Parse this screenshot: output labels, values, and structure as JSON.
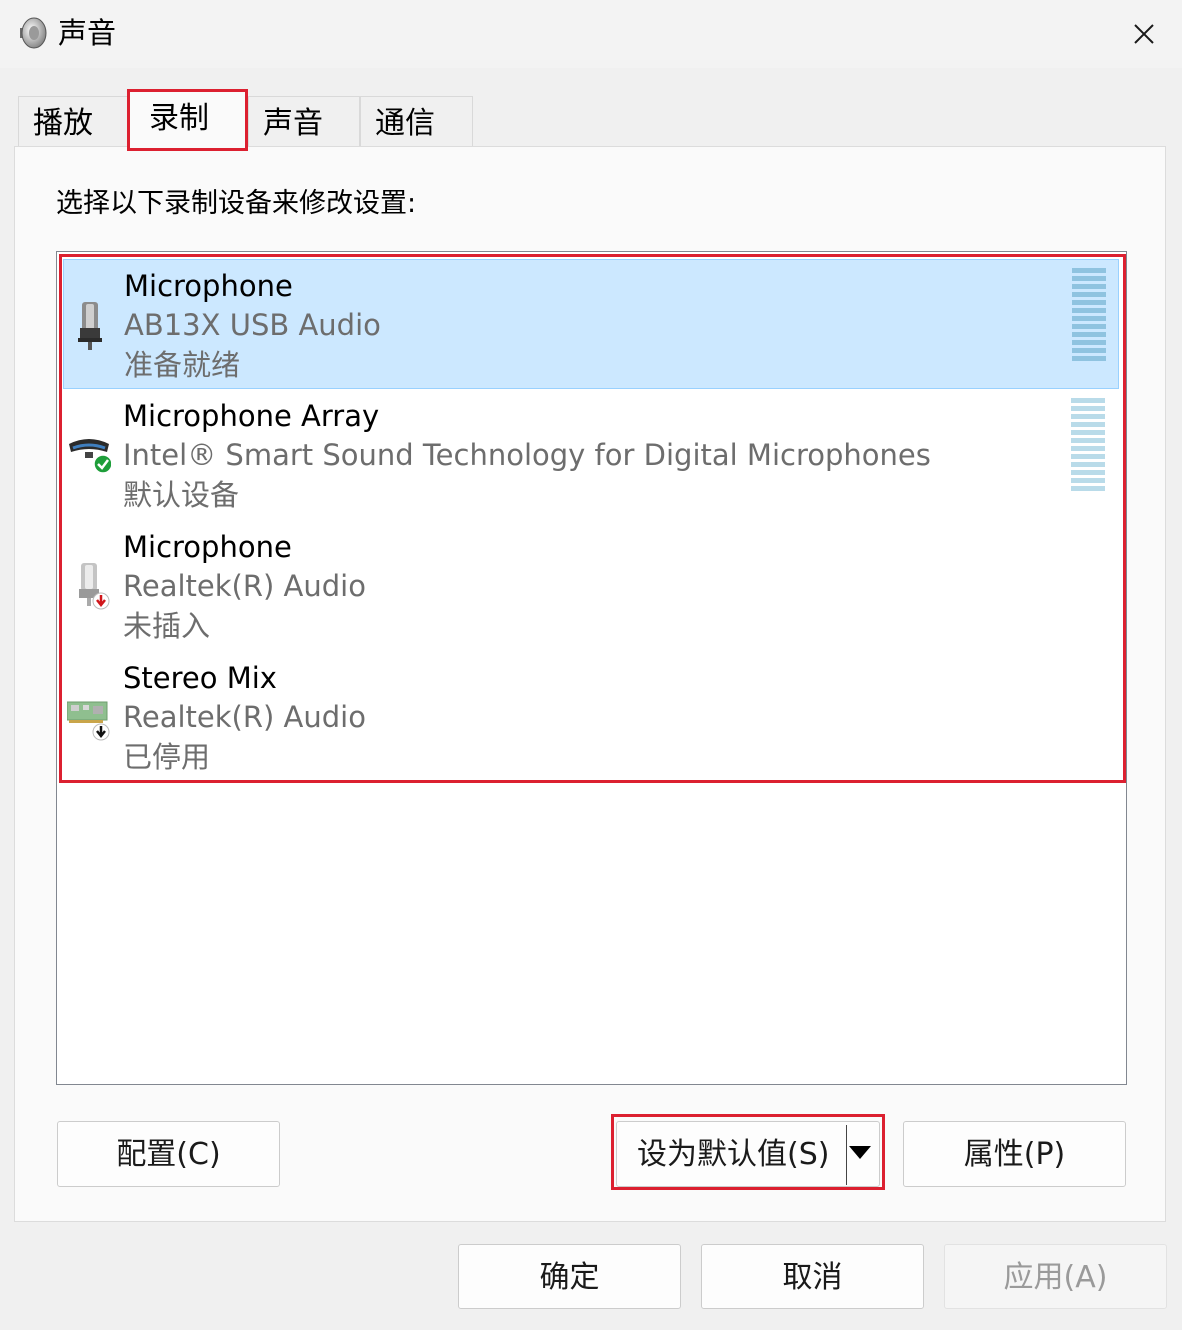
{
  "window": {
    "title": "声音",
    "icon": "speaker-icon",
    "close_icon": "close-icon"
  },
  "tabs": [
    {
      "label": "播放",
      "active": false
    },
    {
      "label": "录制",
      "active": true
    },
    {
      "label": "声音",
      "active": false
    },
    {
      "label": "通信",
      "active": false
    }
  ],
  "instruction": "选择以下录制设备来修改设置:",
  "devices": [
    {
      "name": "Microphone",
      "description": "AB13X USB Audio",
      "status": "准备就绪",
      "selected": true,
      "icon": "usb-microphone-icon"
    },
    {
      "name": "Microphone Array",
      "description": "Intel® Smart Sound Technology for Digital Microphones",
      "status": "默认设备",
      "selected": false,
      "icon": "microphone-array-default-icon"
    },
    {
      "name": "Microphone",
      "description": "Realtek(R) Audio",
      "status": "未插入",
      "selected": false,
      "icon": "microphone-unplugged-icon"
    },
    {
      "name": "Stereo Mix",
      "description": "Realtek(R) Audio",
      "status": "已停用",
      "selected": false,
      "icon": "sound-card-disabled-icon"
    }
  ],
  "buttons": {
    "configure": "配置(C)",
    "set_default": "设为默认值(S)",
    "properties": "属性(P)",
    "ok": "确定",
    "cancel": "取消",
    "apply": "应用(A)"
  },
  "colors": {
    "selection": "#cce8ff",
    "highlight_box": "#dc2030",
    "level_meter": "#8fc3e0"
  }
}
